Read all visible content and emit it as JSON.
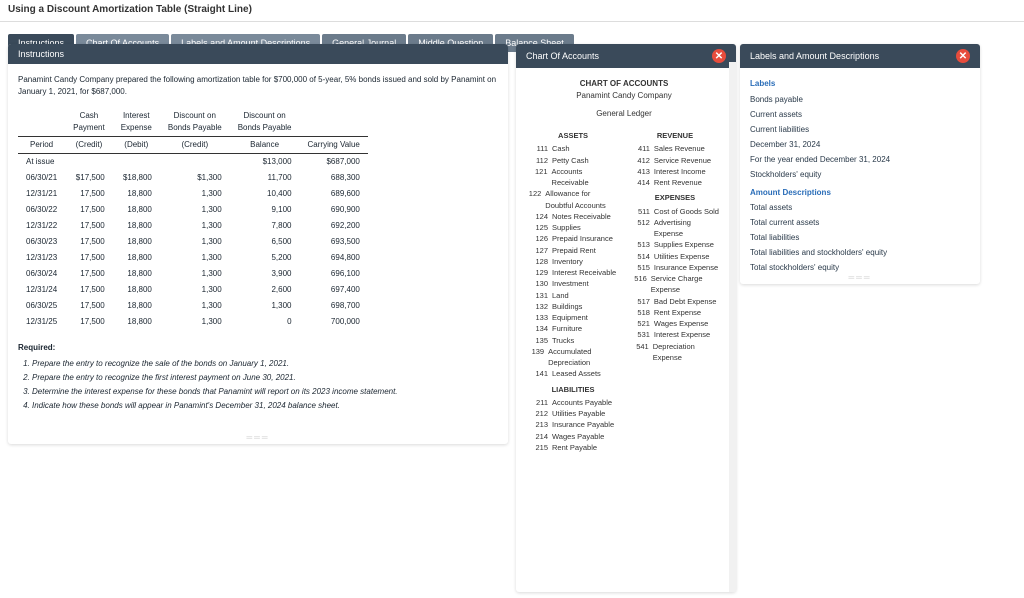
{
  "page_title": "Using a Discount Amortization Table (Straight Line)",
  "tabs": [
    "Instructions",
    "Chart Of Accounts",
    "Labels and Amount Descriptions",
    "General Journal",
    "Middle Question",
    "Balance Sheet"
  ],
  "instructions": {
    "header": "Instructions",
    "intro": "Panamint Candy Company prepared the following amortization table for $700,000 of 5-year, 5% bonds issued and sold by Panamint on January 1, 2021, for $687,000.",
    "cols": {
      "c0": "Period",
      "c1a": "Cash",
      "c1b": "Payment",
      "c1c": "(Credit)",
      "c2a": "Interest",
      "c2b": "Expense",
      "c2c": "(Debit)",
      "c3a": "Discount on",
      "c3b": "Bonds Payable",
      "c3c": "(Credit)",
      "c4a": "Discount on",
      "c4b": "Bonds Payable",
      "c4c": "Balance",
      "c5": "Carrying Value"
    },
    "rows": [
      {
        "p": "At issue",
        "a": "",
        "b": "",
        "c": "",
        "d": "$13,000",
        "e": "$687,000"
      },
      {
        "p": "06/30/21",
        "a": "$17,500",
        "b": "$18,800",
        "c": "$1,300",
        "d": "11,700",
        "e": "688,300"
      },
      {
        "p": "12/31/21",
        "a": "17,500",
        "b": "18,800",
        "c": "1,300",
        "d": "10,400",
        "e": "689,600"
      },
      {
        "p": "06/30/22",
        "a": "17,500",
        "b": "18,800",
        "c": "1,300",
        "d": "9,100",
        "e": "690,900"
      },
      {
        "p": "12/31/22",
        "a": "17,500",
        "b": "18,800",
        "c": "1,300",
        "d": "7,800",
        "e": "692,200"
      },
      {
        "p": "06/30/23",
        "a": "17,500",
        "b": "18,800",
        "c": "1,300",
        "d": "6,500",
        "e": "693,500"
      },
      {
        "p": "12/31/23",
        "a": "17,500",
        "b": "18,800",
        "c": "1,300",
        "d": "5,200",
        "e": "694,800"
      },
      {
        "p": "06/30/24",
        "a": "17,500",
        "b": "18,800",
        "c": "1,300",
        "d": "3,900",
        "e": "696,100"
      },
      {
        "p": "12/31/24",
        "a": "17,500",
        "b": "18,800",
        "c": "1,300",
        "d": "2,600",
        "e": "697,400"
      },
      {
        "p": "06/30/25",
        "a": "17,500",
        "b": "18,800",
        "c": "1,300",
        "d": "1,300",
        "e": "698,700"
      },
      {
        "p": "12/31/25",
        "a": "17,500",
        "b": "18,800",
        "c": "1,300",
        "d": "0",
        "e": "700,000"
      }
    ],
    "req_title": "Required:",
    "reqs": [
      "Prepare the entry to recognize the sale of the bonds on January 1, 2021.",
      "Prepare the entry to recognize the first interest payment on June 30, 2021.",
      "Determine the interest expense for these bonds that Panamint will report on its 2023 income statement.",
      "Indicate how these bonds will appear in Panamint's December 31, 2024 balance sheet."
    ]
  },
  "coa": {
    "header": "Chart Of Accounts",
    "title": "CHART OF ACCOUNTS",
    "company": "Panamint Candy Company",
    "ledger": "General Ledger",
    "sections": {
      "assets": "ASSETS",
      "rev": "REVENUE",
      "liab": "LIABILITIES",
      "exp": "EXPENSES"
    },
    "assets": [
      {
        "n": "111",
        "t": "Cash"
      },
      {
        "n": "112",
        "t": "Petty Cash"
      },
      {
        "n": "121",
        "t": "Accounts Receivable"
      },
      {
        "n": "122",
        "t": "Allowance for Doubtful Accounts"
      },
      {
        "n": "124",
        "t": "Notes Receivable"
      },
      {
        "n": "125",
        "t": "Supplies"
      },
      {
        "n": "126",
        "t": "Prepaid Insurance"
      },
      {
        "n": "127",
        "t": "Prepaid Rent"
      },
      {
        "n": "128",
        "t": "Inventory"
      },
      {
        "n": "129",
        "t": "Interest Receivable"
      },
      {
        "n": "130",
        "t": "Investment"
      },
      {
        "n": "131",
        "t": "Land"
      },
      {
        "n": "132",
        "t": "Buildings"
      },
      {
        "n": "133",
        "t": "Equipment"
      },
      {
        "n": "134",
        "t": "Furniture"
      },
      {
        "n": "135",
        "t": "Trucks"
      },
      {
        "n": "139",
        "t": "Accumulated Depreciation"
      },
      {
        "n": "141",
        "t": "Leased Assets"
      }
    ],
    "revenue": [
      {
        "n": "411",
        "t": "Sales Revenue"
      },
      {
        "n": "412",
        "t": "Service Revenue"
      },
      {
        "n": "413",
        "t": "Interest Income"
      },
      {
        "n": "414",
        "t": "Rent Revenue"
      }
    ],
    "expenses": [
      {
        "n": "511",
        "t": "Cost of Goods Sold"
      },
      {
        "n": "512",
        "t": "Advertising Expense"
      },
      {
        "n": "513",
        "t": "Supplies Expense"
      },
      {
        "n": "514",
        "t": "Utilities Expense"
      },
      {
        "n": "515",
        "t": "Insurance Expense"
      },
      {
        "n": "516",
        "t": "Service Charge Expense"
      },
      {
        "n": "517",
        "t": "Bad Debt Expense"
      },
      {
        "n": "518",
        "t": "Rent Expense"
      },
      {
        "n": "521",
        "t": "Wages Expense"
      },
      {
        "n": "531",
        "t": "Interest Expense"
      },
      {
        "n": "541",
        "t": "Depreciation Expense"
      }
    ],
    "liabilities": [
      {
        "n": "211",
        "t": "Accounts Payable"
      },
      {
        "n": "212",
        "t": "Utilities Payable"
      },
      {
        "n": "213",
        "t": "Insurance Payable"
      },
      {
        "n": "214",
        "t": "Wages Payable"
      },
      {
        "n": "215",
        "t": "Rent Payable"
      }
    ]
  },
  "labels": {
    "header": "Labels and Amount Descriptions",
    "heading1": "Labels",
    "items1": [
      "Bonds payable",
      "Current assets",
      "Current liabilities",
      "December 31, 2024",
      "For the year ended December 31, 2024",
      "Stockholders' equity"
    ],
    "heading2": "Amount Descriptions",
    "items2": [
      "Total assets",
      "Total current assets",
      "Total liabilities",
      "Total liabilities and stockholders' equity",
      "Total stockholders' equity"
    ]
  }
}
